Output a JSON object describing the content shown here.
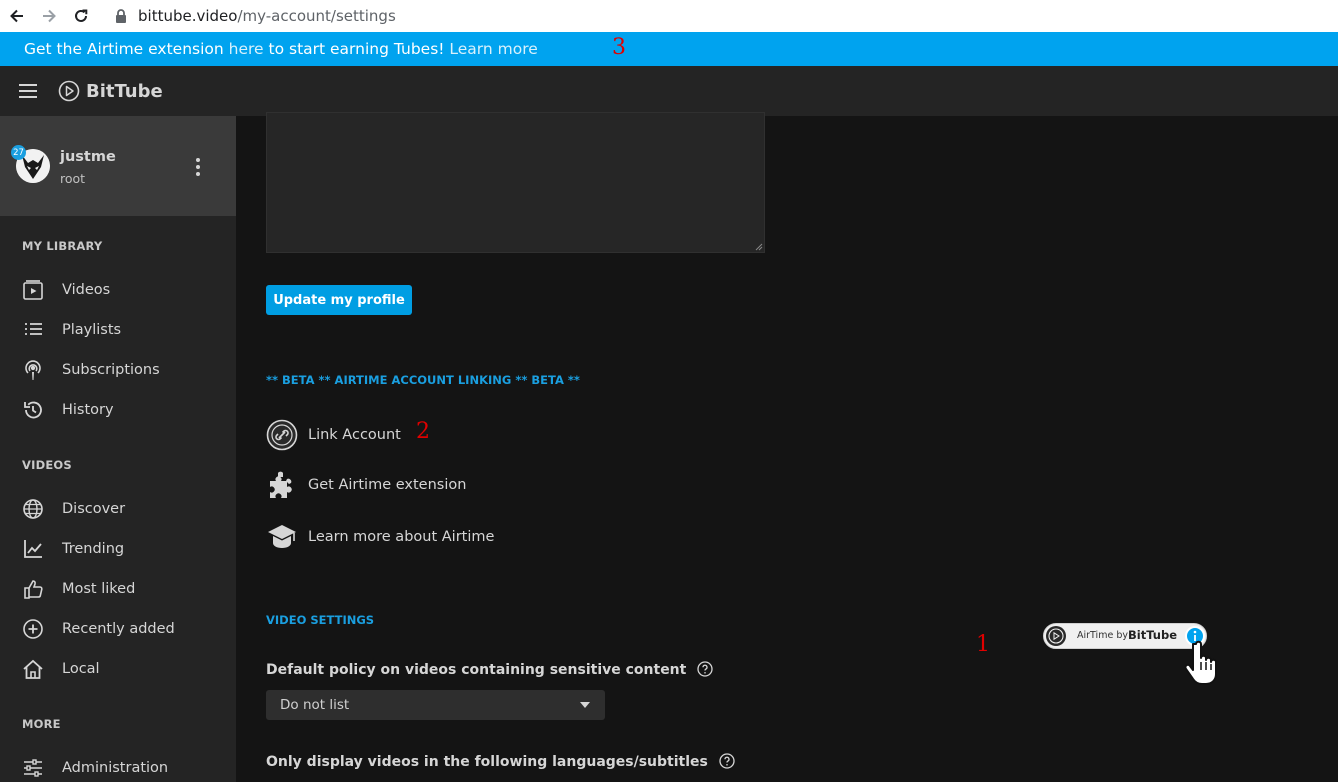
{
  "browser": {
    "url_host": "bittube.video",
    "url_path": "/my-account/settings"
  },
  "banner": {
    "text_prefix": "Get the Airtime extension ",
    "link_here": "here",
    "text_middle": " to start earning Tubes! ",
    "link_learn": "Learn more"
  },
  "app": {
    "brand": "BitTube"
  },
  "user": {
    "name": "justme",
    "role": "root",
    "badge_count": "27"
  },
  "sidebar": {
    "sections": [
      {
        "title": "MY LIBRARY",
        "items": [
          {
            "label": "Videos",
            "icon": "video-icon"
          },
          {
            "label": "Playlists",
            "icon": "list-icon"
          },
          {
            "label": "Subscriptions",
            "icon": "podcast-icon"
          },
          {
            "label": "History",
            "icon": "history-icon"
          }
        ]
      },
      {
        "title": "VIDEOS",
        "items": [
          {
            "label": "Discover",
            "icon": "globe-icon"
          },
          {
            "label": "Trending",
            "icon": "trending-icon"
          },
          {
            "label": "Most liked",
            "icon": "thumbs-up-icon"
          },
          {
            "label": "Recently added",
            "icon": "plus-circle-icon"
          },
          {
            "label": "Local",
            "icon": "home-icon"
          }
        ]
      },
      {
        "title": "MORE",
        "items": [
          {
            "label": "Administration",
            "icon": "sliders-icon"
          }
        ]
      }
    ]
  },
  "profile": {
    "update_button": "Update my profile"
  },
  "airtime": {
    "heading": "** BETA ** AIRTIME ACCOUNT LINKING ** BETA **",
    "link_account": "Link Account",
    "get_extension": "Get Airtime extension",
    "learn_more": "Learn more about Airtime"
  },
  "video_settings": {
    "heading": "VIDEO SETTINGS",
    "sensitive_label": "Default policy on videos containing sensitive content",
    "sensitive_value": "Do not list",
    "languages_label": "Only display videos in the following languages/subtitles"
  },
  "airtime_pill": {
    "prefix": "AirTime by ",
    "brand": "BitTube"
  },
  "annotations": {
    "one": "1",
    "two": "2",
    "three": "3"
  },
  "colors": {
    "accent": "#009ee3",
    "banner": "#00a3ef",
    "sidebar_bg": "#242424",
    "main_bg": "#141414",
    "annotation": "#e00000"
  }
}
